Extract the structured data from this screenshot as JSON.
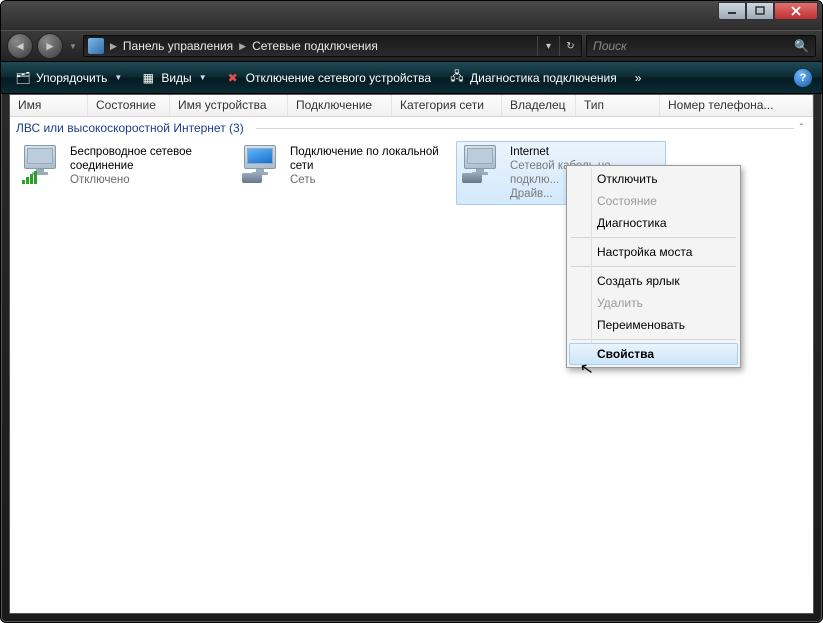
{
  "breadcrumb": {
    "item1": "Панель управления",
    "item2": "Сетевые подключения"
  },
  "search": {
    "placeholder": "Поиск"
  },
  "toolbar": {
    "organize": "Упорядочить",
    "views": "Виды",
    "disable": "Отключение сетевого устройства",
    "diagnose": "Диагностика подключения",
    "chevron": "»"
  },
  "columns": {
    "name": "Имя",
    "state": "Состояние",
    "devname": "Имя устройства",
    "connectivity": "Подключение",
    "category": "Категория сети",
    "owner": "Владелец",
    "type": "Тип",
    "phone": "Номер телефона..."
  },
  "group": {
    "title": "ЛВС или высокоскоростной Интернет (3)"
  },
  "items": [
    {
      "l1": "Беспроводное сетевое",
      "l2": "соединение",
      "l3": "Отключено"
    },
    {
      "l1": "Подключение по локальной",
      "l2": "сети",
      "l3": "Сеть"
    },
    {
      "l1": "Internet",
      "l2": "Сетевой кабель не подклю...",
      "l3": "Драйв..."
    }
  ],
  "ctx": {
    "disable": "Отключить",
    "status": "Состояние",
    "diagnose": "Диагностика",
    "bridge": "Настройка моста",
    "shortcut": "Создать ярлык",
    "delete": "Удалить",
    "rename": "Переименовать",
    "properties": "Свойства"
  }
}
